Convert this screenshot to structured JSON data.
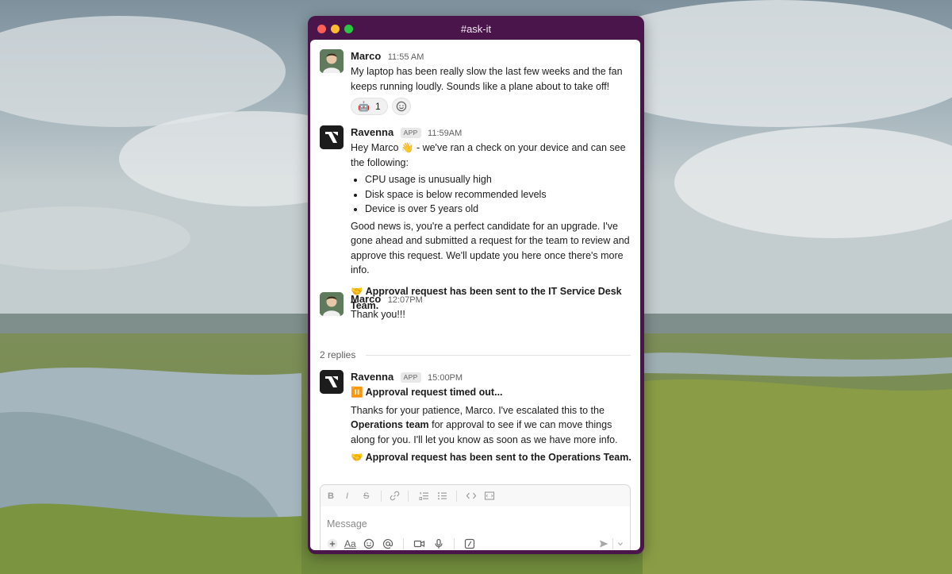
{
  "window": {
    "title": "#ask-it"
  },
  "messages": [
    {
      "author": "Marco",
      "time": "11:55 AM",
      "text": "My laptop has been really slow the last few weeks and the fan keeps running loudly. Sounds like a plane about to take off!",
      "reaction": {
        "emoji": "🤖",
        "count": "1"
      }
    },
    {
      "author": "Ravenna",
      "badge": "APP",
      "time": "11:59AM",
      "intro": "Hey Marco 👋 - we've ran a check on your device and can see the following:",
      "bullets": [
        "CPU usage is unusually high",
        "Disk space is below recommended levels",
        "Device is over 5 years old"
      ],
      "paragraph": "Good news is, you're a perfect candidate for an upgrade. I've gone ahead and submitted a request for the team to review and approve this request. We'll update you here once there's more info.",
      "notice": "🤝 Approval request has been sent to the IT Service Desk Team."
    },
    {
      "author": "Marco",
      "time": "12:07PM",
      "text": "Thank you!!!"
    },
    {
      "author": "Ravenna",
      "badge": "APP",
      "time": "15:00PM",
      "status": "⏸️ Approval request timed out...",
      "paragraph_prefix": "Thanks for your patience, Marco. I've escalated this to the ",
      "paragraph_bold": "Operations team",
      "paragraph_suffix": " for approval to see if we can move things along for you. I'll let you know as soon as we have more info.",
      "notice": "🤝 Approval request has been sent to the Operations Team."
    }
  ],
  "thread": {
    "replies_label": "2 replies"
  },
  "composer": {
    "placeholder": "Message",
    "format_icons": [
      "bold-icon",
      "italic-icon",
      "strikethrough-icon",
      "link-icon",
      "ordered-list-icon",
      "bulleted-list-icon",
      "code-icon",
      "code-block-icon"
    ],
    "action_icons": [
      "plus-icon",
      "text-format-icon",
      "emoji-icon",
      "mention-icon",
      "video-icon",
      "microphone-icon",
      "slash-command-icon",
      "send-icon",
      "chevron-down-icon"
    ],
    "format_glyphs": {
      "bold": "B",
      "italic": "I",
      "strike": "S",
      "text_format": "Aa"
    }
  },
  "colors": {
    "window_chrome": "#4a154b",
    "panel": "#ffffff",
    "text": "#1d1c1d",
    "muted": "#616061"
  }
}
